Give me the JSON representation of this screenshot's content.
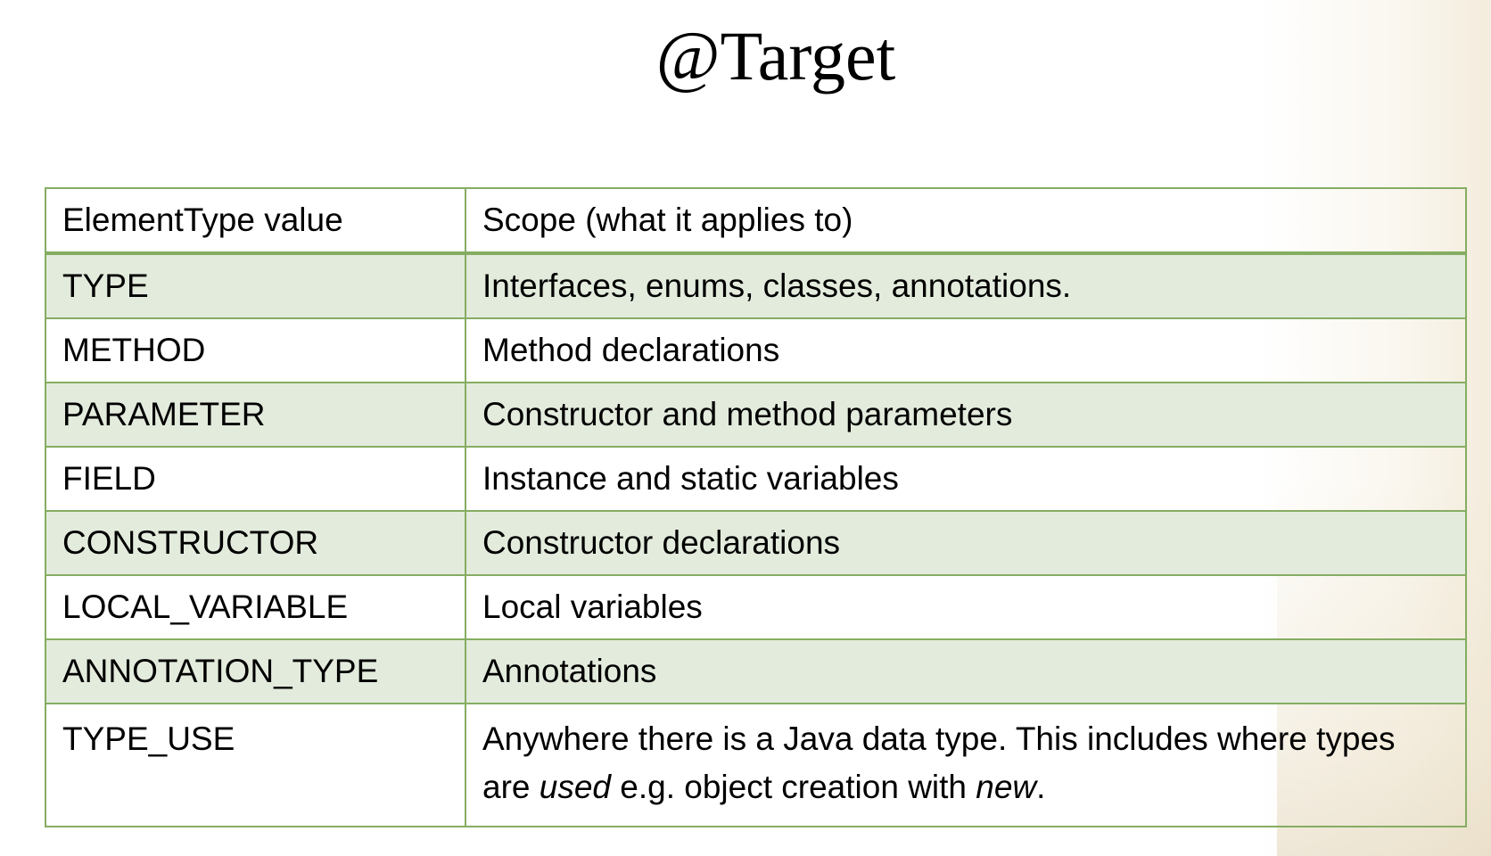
{
  "title": "@Target",
  "table": {
    "headers": [
      "ElementType value",
      "Scope (what it applies to)"
    ],
    "rows": [
      {
        "type": "TYPE",
        "scope": "Interfaces, enums, classes, annotations."
      },
      {
        "type": "METHOD",
        "scope": "Method declarations"
      },
      {
        "type": "PARAMETER",
        "scope": "Constructor and method parameters"
      },
      {
        "type": "FIELD",
        "scope": "Instance and static variables"
      },
      {
        "type": "CONSTRUCTOR",
        "scope": "Constructor declarations"
      },
      {
        "type": "LOCAL_VARIABLE",
        "scope": "Local variables"
      },
      {
        "type": "ANNOTATION_TYPE",
        "scope": "Annotations"
      },
      {
        "type": "TYPE_USE",
        "scope_parts": [
          "Anywhere there is a Java data type. This includes where types are ",
          "used",
          " e.g. object creation with ",
          "new",
          "."
        ]
      }
    ]
  },
  "colors": {
    "border": "#85ad62",
    "shaded_row": "#e3ebdd"
  }
}
